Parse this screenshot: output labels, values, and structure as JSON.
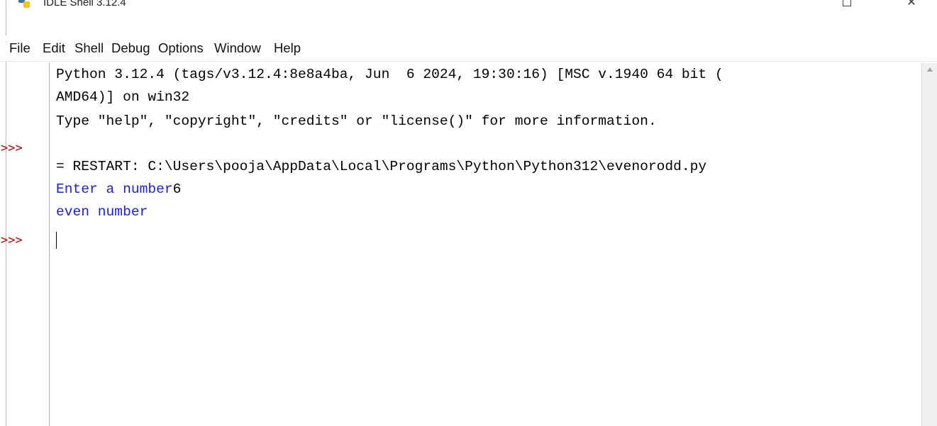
{
  "window": {
    "title": "IDLE Shell 3.12.4",
    "maximize_icon": "maximize-icon",
    "close_icon": "close-icon",
    "close_glyph": "✕"
  },
  "menu": {
    "items": [
      "File",
      "Edit",
      "Shell",
      "Debug",
      "Options",
      "Window",
      "Help"
    ]
  },
  "shell": {
    "prompt": ">>>",
    "lines": [
      "Python 3.12.4 (tags/v3.12.4:8e8a4ba, Jun  6 2024, 19:30:16) [MSC v.1940 64 bit (",
      "AMD64)] on win32",
      "Type \"help\", \"copyright\", \"credits\" or \"license()\" for more information.",
      "= RESTART: C:\\Users\\pooja\\AppData\\Local\\Programs\\Python\\Python312\\evenorodd.py",
      "Enter a number",
      "6",
      "even number"
    ]
  },
  "colors": {
    "prompt": "#c00000",
    "output": "#1a1aff",
    "input": "#000000"
  }
}
